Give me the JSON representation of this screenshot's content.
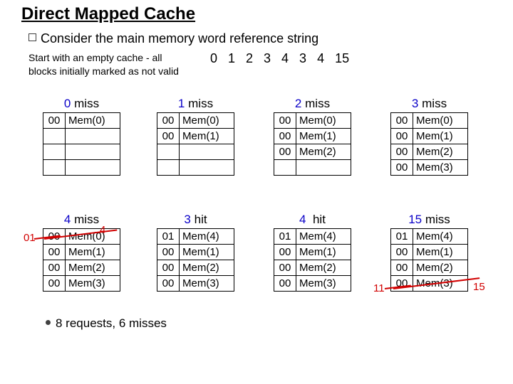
{
  "title": "Direct Mapped Cache",
  "intro": "Consider the main memory word reference string",
  "subnote": "Start with an empty cache - all blocks initially marked as not valid",
  "ref_string": "0   1   2   3   4   3   4   15",
  "footer": "8 requests, 6 misses",
  "labels": {
    "miss": "miss",
    "hit": "hit"
  },
  "caches": {
    "t0": {
      "num": "0",
      "outcome": "miss",
      "rows": [
        {
          "tag": "00",
          "data": "Mem(0)"
        },
        {
          "tag": "",
          "data": ""
        },
        {
          "tag": "",
          "data": ""
        },
        {
          "tag": "",
          "data": ""
        }
      ]
    },
    "t1": {
      "num": "1",
      "outcome": "miss",
      "rows": [
        {
          "tag": "00",
          "data": "Mem(0)"
        },
        {
          "tag": "00",
          "data": "Mem(1)"
        },
        {
          "tag": "",
          "data": ""
        },
        {
          "tag": "",
          "data": ""
        }
      ]
    },
    "t2": {
      "num": "2",
      "outcome": "miss",
      "rows": [
        {
          "tag": "00",
          "data": "Mem(0)"
        },
        {
          "tag": "00",
          "data": "Mem(1)"
        },
        {
          "tag": "00",
          "data": "Mem(2)"
        },
        {
          "tag": "",
          "data": ""
        }
      ]
    },
    "t3": {
      "num": "3",
      "outcome": "miss",
      "rows": [
        {
          "tag": "00",
          "data": "Mem(0)"
        },
        {
          "tag": "00",
          "data": "Mem(1)"
        },
        {
          "tag": "00",
          "data": "Mem(2)"
        },
        {
          "tag": "00",
          "data": "Mem(3)"
        }
      ]
    },
    "t4": {
      "num": "4",
      "outcome": "miss",
      "rows": [
        {
          "tag": "00",
          "data": "Mem(0)"
        },
        {
          "tag": "00",
          "data": "Mem(1)"
        },
        {
          "tag": "00",
          "data": "Mem(2)"
        },
        {
          "tag": "00",
          "data": "Mem(3)"
        }
      ]
    },
    "t5": {
      "num": "3",
      "outcome": "hit",
      "rows": [
        {
          "tag": "01",
          "data": "Mem(4)"
        },
        {
          "tag": "00",
          "data": "Mem(1)"
        },
        {
          "tag": "00",
          "data": "Mem(2)"
        },
        {
          "tag": "00",
          "data": "Mem(3)"
        }
      ]
    },
    "t6": {
      "num": "4",
      "outcome": "hit",
      "rows": [
        {
          "tag": "01",
          "data": "Mem(4)"
        },
        {
          "tag": "00",
          "data": "Mem(1)"
        },
        {
          "tag": "00",
          "data": "Mem(2)"
        },
        {
          "tag": "00",
          "data": "Mem(3)"
        }
      ]
    },
    "t7": {
      "num": "15",
      "outcome": "miss",
      "rows": [
        {
          "tag": "01",
          "data": "Mem(4)"
        },
        {
          "tag": "00",
          "data": "Mem(1)"
        },
        {
          "tag": "00",
          "data": "Mem(2)"
        },
        {
          "tag": "00",
          "data": "Mem(3)"
        }
      ]
    }
  },
  "annot": {
    "t4_new_tag": "01",
    "t4_new_data": "4",
    "t7_new_tag": "11",
    "t7_new_data": "15"
  }
}
